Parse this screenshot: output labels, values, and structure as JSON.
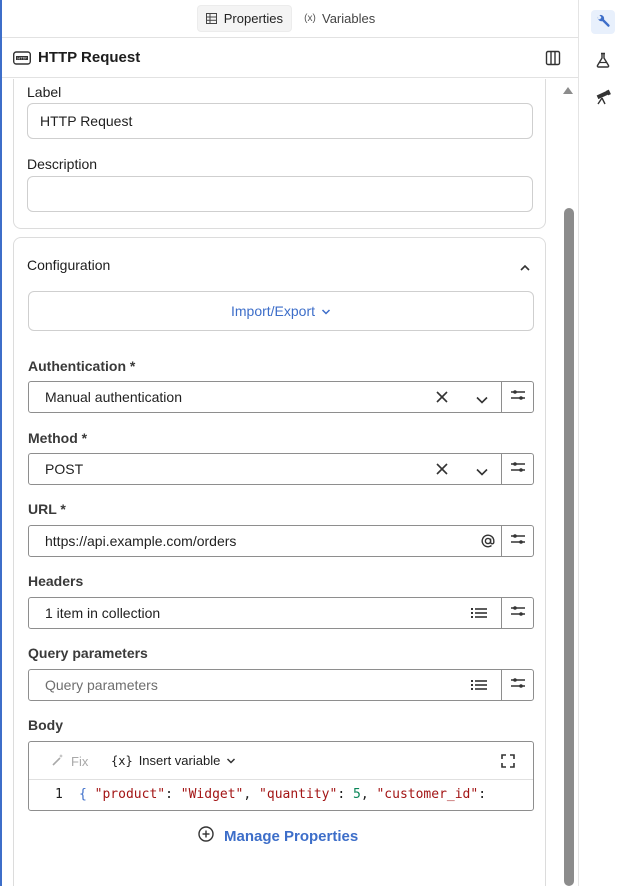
{
  "tabs": [
    {
      "label": "Properties",
      "icon": "table-icon",
      "active": true
    },
    {
      "label": "Variables",
      "icon": "variable-icon",
      "active": false
    }
  ],
  "header": {
    "title": "HTTP Request",
    "icon": "http-node-icon"
  },
  "general": {
    "label_title": "Label",
    "label_value": "HTTP Request",
    "description_title": "Description",
    "description_value": ""
  },
  "configuration": {
    "title": "Configuration",
    "import_export": "Import/Export",
    "fields": {
      "authentication": {
        "label": "Authentication *",
        "value": "Manual authentication"
      },
      "method": {
        "label": "Method *",
        "value": "POST"
      },
      "url": {
        "label": "URL *",
        "value": "https://api.example.com/orders"
      },
      "headers": {
        "label": "Headers",
        "value": "1 item in collection"
      },
      "query": {
        "label": "Query parameters",
        "placeholder": "Query parameters"
      }
    },
    "body": {
      "label": "Body",
      "fix_label": "Fix",
      "insert_label": "Insert variable",
      "insert_glyph": "{x}",
      "line_number": "1",
      "tokens": [
        {
          "t": "{ ",
          "c": "b"
        },
        {
          "t": "\"product\"",
          "c": "s"
        },
        {
          "t": ": ",
          "c": "p"
        },
        {
          "t": "\"Widget\"",
          "c": "s"
        },
        {
          "t": ", ",
          "c": "p"
        },
        {
          "t": "\"quantity\"",
          "c": "s"
        },
        {
          "t": ": ",
          "c": "p"
        },
        {
          "t": "5",
          "c": "n"
        },
        {
          "t": ", ",
          "c": "p"
        },
        {
          "t": "\"customer_id\"",
          "c": "s"
        },
        {
          "t": ":",
          "c": "p"
        }
      ]
    },
    "manage_properties": "Manage Properties"
  },
  "rightbar": [
    {
      "icon": "wrench-icon",
      "active": true
    },
    {
      "icon": "flask-icon",
      "active": false
    },
    {
      "icon": "telescope-icon",
      "active": false
    }
  ],
  "colors": {
    "accent": "#3d6ec9",
    "border": "#8e8e8e"
  }
}
